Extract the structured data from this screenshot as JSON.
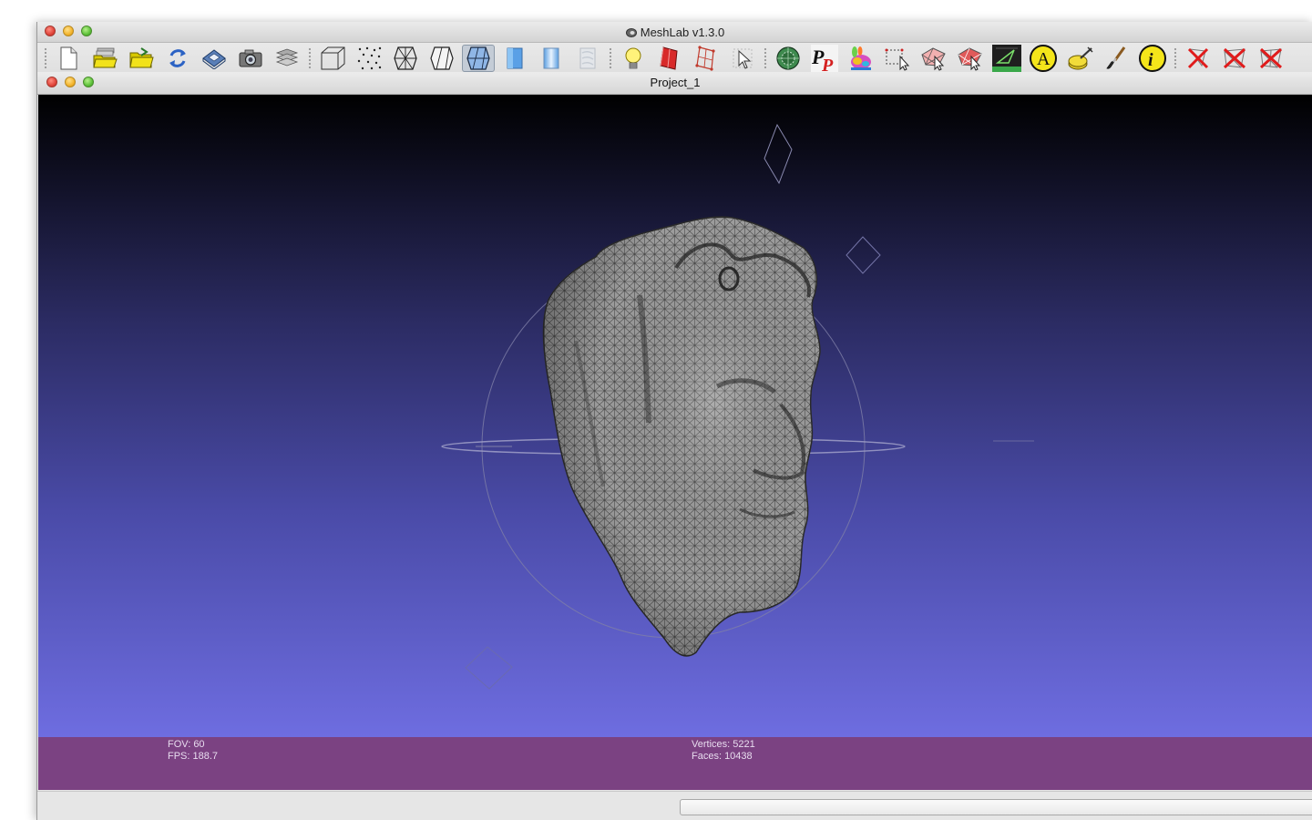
{
  "window": {
    "title": "MeshLab v1.3.0"
  },
  "document": {
    "title": "Project_1"
  },
  "toolbar": {
    "buttons": [
      {
        "name": "new-project",
        "icon": "new-document-icon"
      },
      {
        "name": "open-project",
        "icon": "layered-folder-icon"
      },
      {
        "name": "import-mesh",
        "icon": "open-folder-icon"
      },
      {
        "name": "reload",
        "icon": "reload-icon"
      },
      {
        "name": "save",
        "icon": "save-disk-icon"
      },
      {
        "name": "snapshot",
        "icon": "camera-icon"
      },
      {
        "name": "layers",
        "icon": "layers-icon"
      },
      {
        "name": "bounding-box",
        "icon": "bbox-cube-icon"
      },
      {
        "name": "points",
        "icon": "points-icon"
      },
      {
        "name": "wireframe",
        "icon": "wireframe-icon"
      },
      {
        "name": "hidden-lines",
        "icon": "hidden-lines-icon"
      },
      {
        "name": "flat-lines",
        "icon": "flat-lines-icon"
      },
      {
        "name": "flat",
        "icon": "flat-shading-icon"
      },
      {
        "name": "smooth",
        "icon": "smooth-shading-icon"
      },
      {
        "name": "texture",
        "icon": "texture-icon"
      },
      {
        "name": "lighting",
        "icon": "lightbulb-icon"
      },
      {
        "name": "backface-culling",
        "icon": "backface-icon"
      },
      {
        "name": "double-side",
        "icon": "double-side-icon"
      },
      {
        "name": "select-vertex",
        "icon": "select-pointer-icon"
      },
      {
        "name": "manipulator",
        "icon": "manipulator-icon"
      },
      {
        "name": "point-picker",
        "icon": "pp-icon"
      },
      {
        "name": "paint-bunny",
        "icon": "paint-bunny-icon"
      },
      {
        "name": "select-region",
        "icon": "select-region-icon"
      },
      {
        "name": "select-faces",
        "icon": "select-faces-icon"
      },
      {
        "name": "select-connected",
        "icon": "select-connected-icon"
      },
      {
        "name": "align-view",
        "icon": "align-view-icon"
      },
      {
        "name": "align",
        "icon": "align-a-icon"
      },
      {
        "name": "measure",
        "icon": "measure-icon"
      },
      {
        "name": "paint",
        "icon": "paint-brush-icon"
      },
      {
        "name": "info",
        "icon": "info-icon"
      },
      {
        "name": "delete-faces",
        "icon": "delete-faces-icon"
      },
      {
        "name": "delete-vertices",
        "icon": "delete-vertices-icon"
      },
      {
        "name": "delete-all",
        "icon": "delete-all-icon"
      }
    ]
  },
  "info": {
    "fov": "FOV: 60",
    "fps": "FPS:   188.7",
    "vertices": "Vertices: 5221",
    "faces": "Faces: 10438"
  },
  "colors": {
    "viewport_top": "#000000",
    "viewport_bottom": "#6e6de0",
    "infobar": "#7b4282",
    "mesh": "#9a9a9a"
  }
}
